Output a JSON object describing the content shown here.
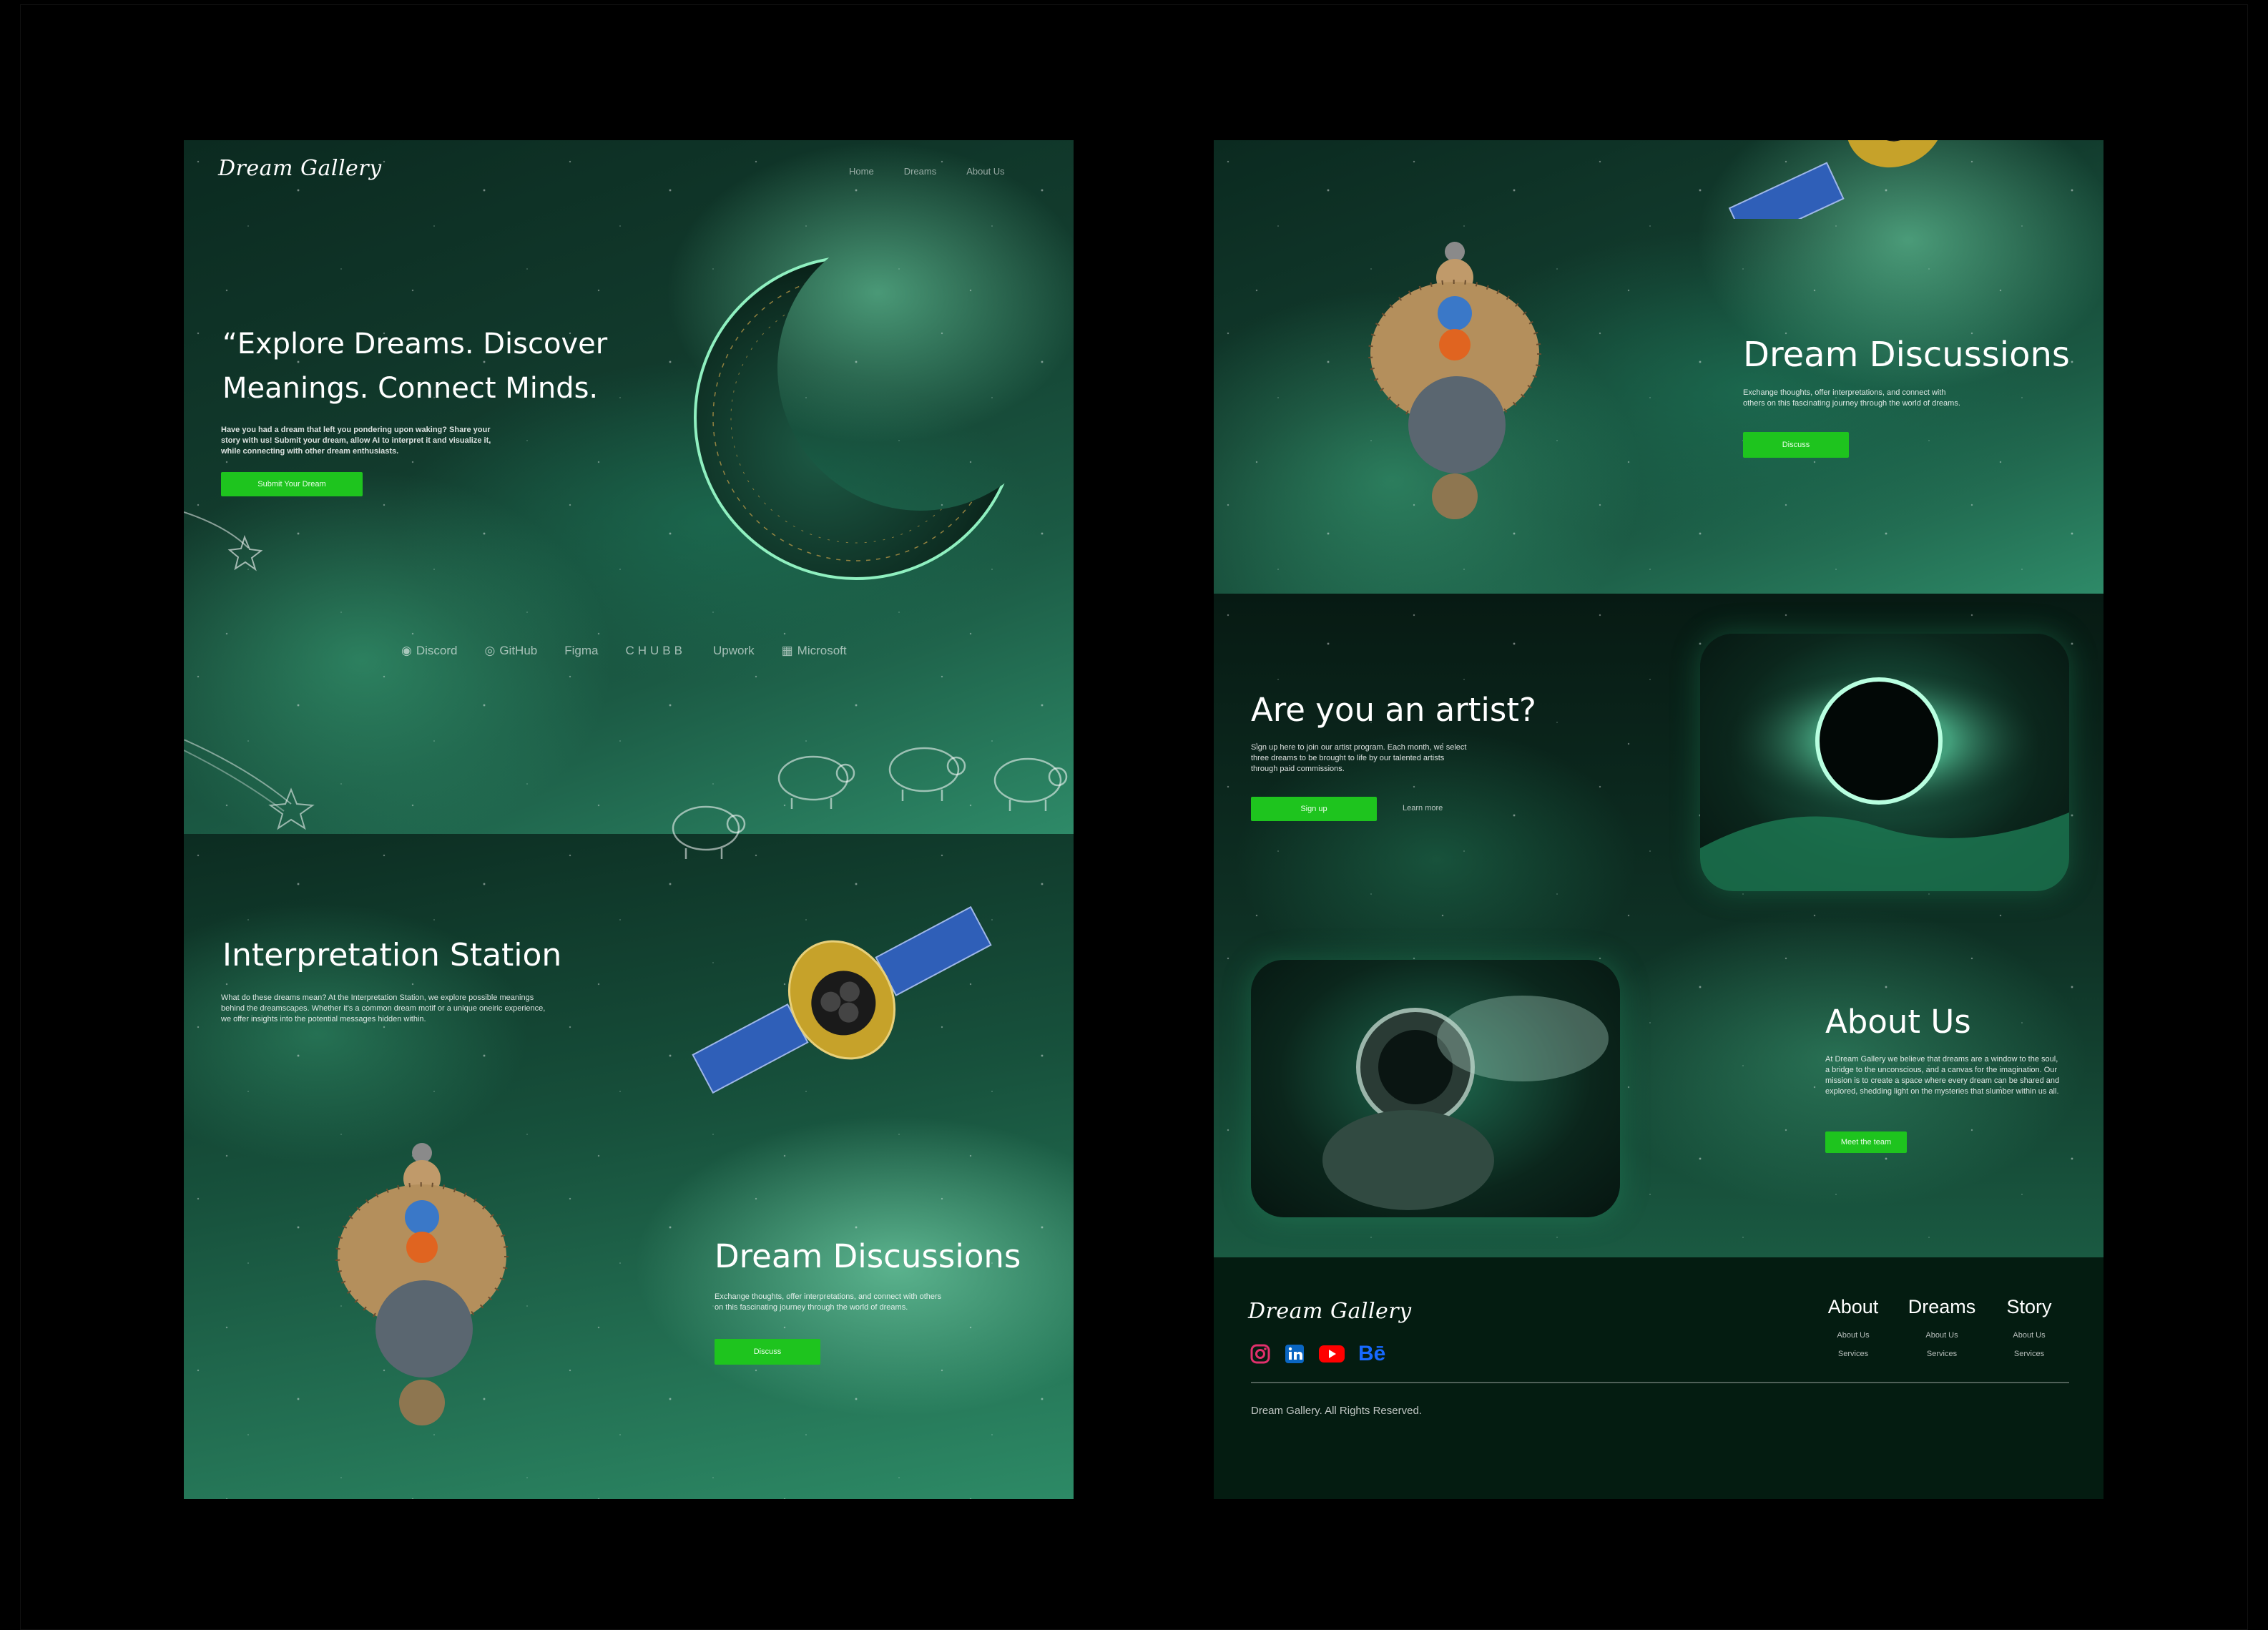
{
  "colors": {
    "accent_button": "#1ec41e",
    "footer_bg": "#041c11",
    "space_green": "#2e8a68"
  },
  "left": {
    "logo": "Dream Gallery",
    "nav": [
      "Home",
      "Dreams",
      "About Us"
    ],
    "hero": {
      "headline_line1": "“Explore Dreams. Discover",
      "headline_line2": "Meanings. Connect Minds.",
      "body": "Have you had a dream that left you pondering upon waking? Share your story with us! Submit your dream, allow AI to interpret it and visualize it, while connecting with other dream enthusiasts.",
      "cta": "Submit Your Dream"
    },
    "partners": [
      {
        "name": "Discord",
        "icon": "discord-icon"
      },
      {
        "name": "GitHub",
        "icon": "github-icon"
      },
      {
        "name": "Figma",
        "icon": ""
      },
      {
        "name": "CHUBB",
        "icon": ""
      },
      {
        "name": "Upwork",
        "icon": ""
      },
      {
        "name": "Microsoft",
        "icon": "microsoft-icon"
      }
    ],
    "interpretation": {
      "title": "Interpretation Station",
      "body": "What do these dreams mean? At the Interpretation Station, we explore possible meanings behind the dreamscapes. Whether it's a common dream motif or a unique oneiric experience, we offer insights into the potential messages hidden within."
    },
    "discussions": {
      "title": "Dream Discussions",
      "body": "Exchange thoughts, offer interpretations, and connect with others on this fascinating journey through the world of dreams.",
      "cta": "Discuss"
    }
  },
  "right": {
    "discussions": {
      "title": "Dream Discussions",
      "body": "Exchange thoughts, offer interpretations, and connect with others on this fascinating journey through the world of dreams.",
      "cta": "Discuss"
    },
    "artist": {
      "title": "Are you an artist?",
      "body": "Sign up here to join our artist program. Each month, we select three dreams to be brought to life by our talented artists through paid commissions.",
      "cta": "Sign up",
      "secondary": "Learn more"
    },
    "about": {
      "title": "About Us",
      "body": "At Dream Gallery we believe that dreams are a window to the soul, a bridge to the unconscious, and a canvas for the imagination. Our mission is to create a space where every dream can be shared and explored, shedding light on the mysteries that slumber within us all.",
      "cta": "Meet the team"
    },
    "footer": {
      "logo": "Dream Gallery",
      "columns": [
        {
          "title": "About",
          "links": [
            "About Us",
            "Services"
          ]
        },
        {
          "title": "Dreams",
          "links": [
            "About Us",
            "Services"
          ]
        },
        {
          "title": "Story",
          "links": [
            "About Us",
            "Services"
          ]
        }
      ],
      "socials": [
        {
          "icon": "instagram-icon",
          "color": "#e1306c"
        },
        {
          "icon": "linkedin-icon",
          "color": "#0a66c2"
        },
        {
          "icon": "youtube-icon",
          "color": "#ff0000"
        },
        {
          "icon": "behance-icon",
          "color": "#1769ff",
          "text": "Bē"
        }
      ],
      "copyright": "Dream Gallery. All Rights Reserved."
    }
  }
}
